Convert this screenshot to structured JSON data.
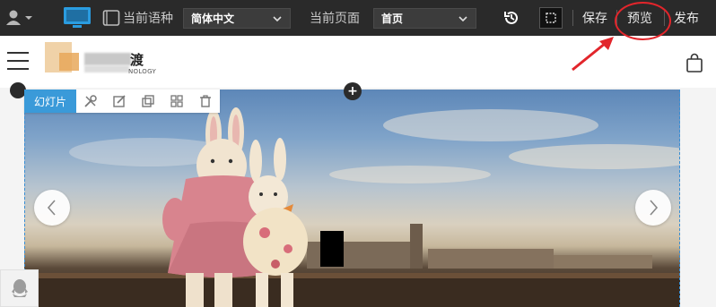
{
  "toolbar": {
    "language_label": "当前语种",
    "language_value": "简体中文",
    "page_label": "当前页面",
    "page_value": "首页",
    "save_label": "保存",
    "preview_label": "预览",
    "publish_label": "发布",
    "accent_color": "#2a2a2a",
    "highlight_color": "#e2252b"
  },
  "header": {
    "logo_text": "渡",
    "logo_subtext": "NOLOGY"
  },
  "component": {
    "label": "幻灯片",
    "tools": [
      "settings-icon",
      "edit-icon",
      "copy-icon",
      "grid-icon",
      "delete-icon"
    ],
    "accent_color": "#3a9ad9"
  },
  "icons": [
    "user-icon",
    "desktop-icon",
    "tablet-icon",
    "history-icon",
    "crop-icon",
    "menu-icon",
    "shopping-bag-icon",
    "chevron-left-icon",
    "chevron-right-icon",
    "qq-icon"
  ]
}
